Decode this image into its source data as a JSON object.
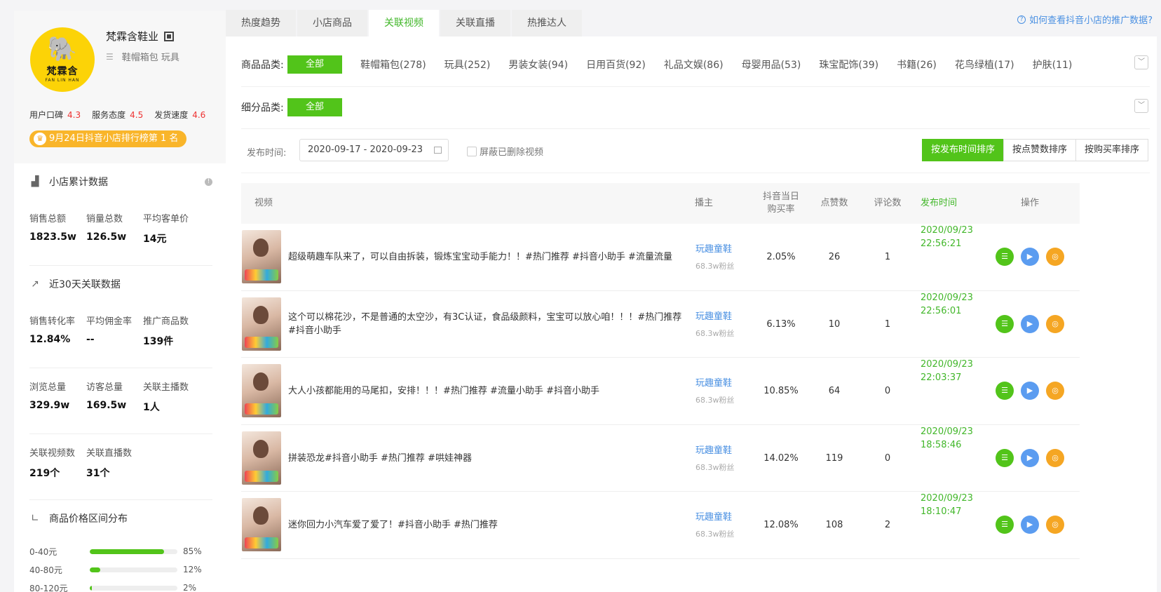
{
  "shop": {
    "logo_text": "梵霖含",
    "logo_sub": "FAN LIN HAN",
    "name": "梵霖含鞋业",
    "categories": "鞋帽箱包 玩具",
    "scores": [
      {
        "label": "用户口碑",
        "value": "4.3"
      },
      {
        "label": "服务态度",
        "value": "4.5"
      },
      {
        "label": "发货速度",
        "value": "4.6"
      }
    ],
    "rank_badge": "9月24日抖音小店排行榜第 1 名"
  },
  "cumulative": {
    "title": "小店累计数据",
    "items": [
      {
        "label": "销售总额",
        "value": "1823.5w"
      },
      {
        "label": "销量总数",
        "value": "126.5w"
      },
      {
        "label": "平均客单价",
        "value": "14元"
      }
    ]
  },
  "recent30": {
    "title": "近30天关联数据",
    "items": [
      {
        "label": "销售转化率",
        "value": "12.84%"
      },
      {
        "label": "平均佣金率",
        "value": "--"
      },
      {
        "label": "推广商品数",
        "value": "139件"
      },
      {
        "label": "浏览总量",
        "value": "329.9w"
      },
      {
        "label": "访客总量",
        "value": "169.5w"
      },
      {
        "label": "关联主播数",
        "value": "1人"
      },
      {
        "label": "关联视频数",
        "value": "219个"
      },
      {
        "label": "关联直播数",
        "value": "31个"
      }
    ]
  },
  "price_dist": {
    "title": "商品价格区间分布",
    "rows": [
      {
        "range": "0-40元",
        "pct_label": "85%",
        "pct": 85
      },
      {
        "range": "40-80元",
        "pct_label": "12%",
        "pct": 12
      },
      {
        "range": "80-120元",
        "pct_label": "2%",
        "pct": 2
      }
    ]
  },
  "tabs": [
    "热度趋势",
    "小店商品",
    "关联视频",
    "关联直播",
    "热推达人"
  ],
  "help_link": "如何查看抖音小店的推广数据?",
  "filters": {
    "category_label": "商品品类:",
    "all_label": "全部",
    "categories": [
      "鞋帽箱包(278)",
      "玩具(252)",
      "男装女装(94)",
      "日用百货(92)",
      "礼品文娱(86)",
      "母婴用品(53)",
      "珠宝配饰(39)",
      "书籍(26)",
      "花鸟绿植(17)",
      "护肤(11)"
    ],
    "subcategory_label": "细分品类:",
    "date_label": "发布时间:",
    "date_range": "2020-09-17 - 2020-09-23",
    "hide_deleted": "屏蔽已删除视频",
    "sorts": [
      "按发布时间排序",
      "按点赞数排序",
      "按购买率排序"
    ]
  },
  "table": {
    "headers": {
      "video": "视频",
      "anchor": "播主",
      "rate_line1": "抖音当日",
      "rate_line2": "购买率",
      "likes": "点赞数",
      "comments": "评论数",
      "time": "发布时间",
      "ops": "操作"
    },
    "rows": [
      {
        "title": "超级萌趣车队来了，可以自由拆装，锻炼宝宝动手能力！！#热门推荐 #抖音小助手 #流量流量",
        "anchor": "玩趣童鞋",
        "fans": "68.3w粉丝",
        "rate": "2.05%",
        "likes": "26",
        "comments": "1",
        "date": "2020/09/23",
        "time": "22:56:21"
      },
      {
        "title": "这个可以棉花沙，不是普通的太空沙，有3C认证，食品级颜料，宝宝可以放心咱！！！#热门推荐 #抖音小助手",
        "anchor": "玩趣童鞋",
        "fans": "68.3w粉丝",
        "rate": "6.13%",
        "likes": "10",
        "comments": "1",
        "date": "2020/09/23",
        "time": "22:56:01"
      },
      {
        "title": "大人小孩都能用的马尾扣，安排！！！#热门推荐 #流量小助手 #抖音小助手",
        "anchor": "玩趣童鞋",
        "fans": "68.3w粉丝",
        "rate": "10.85%",
        "likes": "64",
        "comments": "0",
        "date": "2020/09/23",
        "time": "22:03:37"
      },
      {
        "title": "拼装恐龙#抖音小助手 #热门推荐 #哄娃神器",
        "anchor": "玩趣童鞋",
        "fans": "68.3w粉丝",
        "rate": "14.02%",
        "likes": "119",
        "comments": "0",
        "date": "2020/09/23",
        "time": "18:58:46"
      },
      {
        "title": "迷你回力小汽车爱了爱了！#抖音小助手 #热门推荐",
        "anchor": "玩趣童鞋",
        "fans": "68.3w粉丝",
        "rate": "12.08%",
        "likes": "108",
        "comments": "2",
        "date": "2020/09/23",
        "time": "18:10:47"
      }
    ]
  }
}
